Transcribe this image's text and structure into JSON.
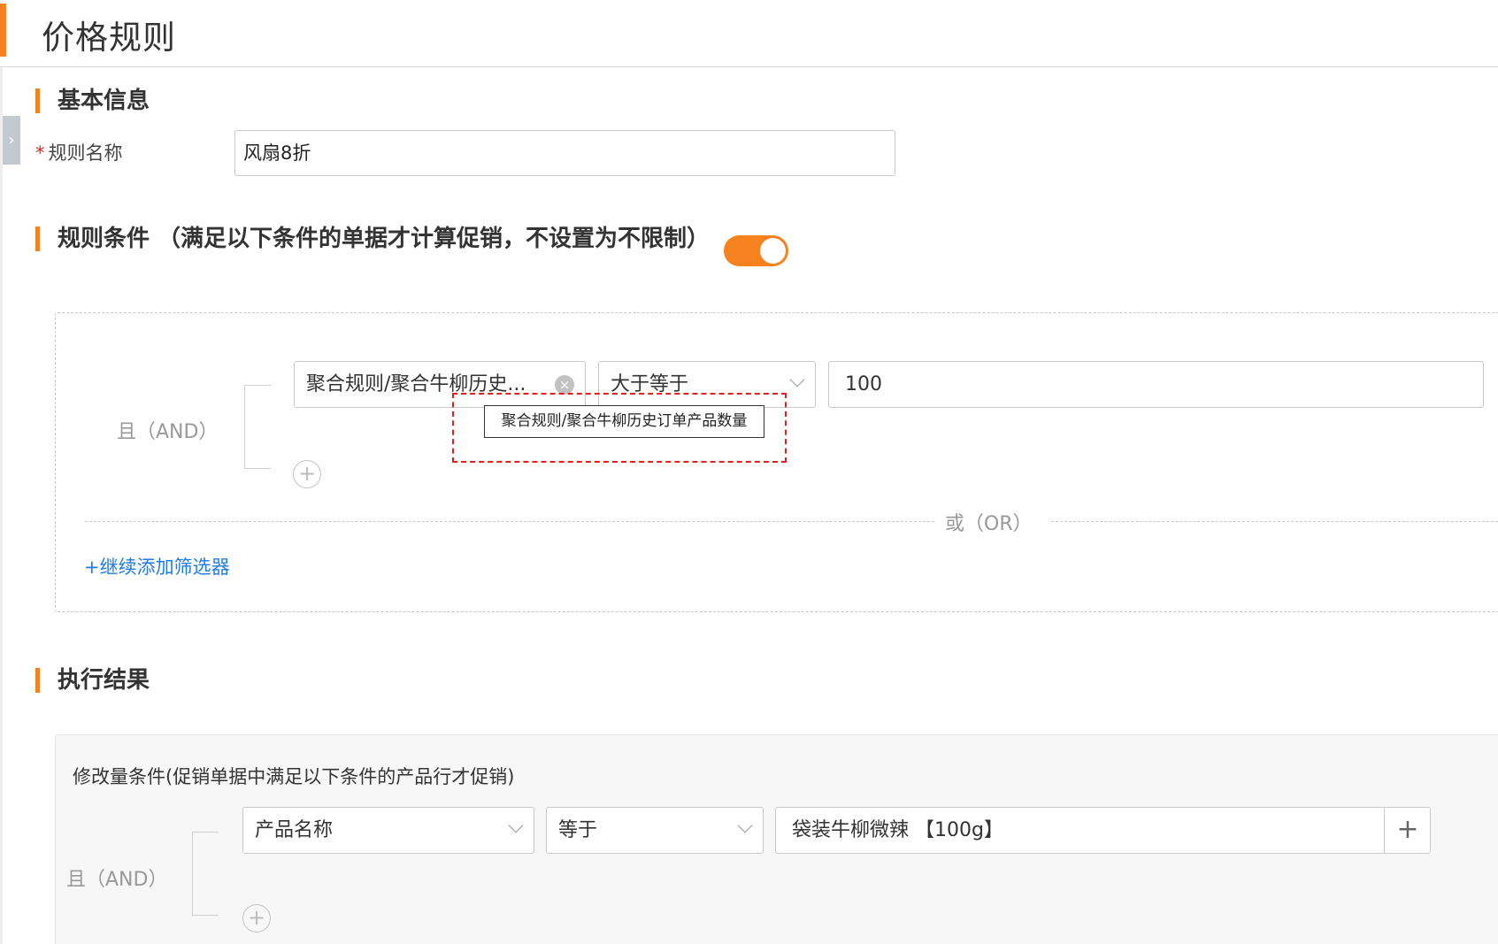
{
  "page": {
    "title": "价格规则"
  },
  "basic_info": {
    "section_title": "基本信息",
    "rule_name_label": "规则名称",
    "required_mark": "*",
    "rule_name_value": "风扇8折"
  },
  "conditions": {
    "section_title": "规则条件 （满足以下条件的单据才计算促销，不设置为不限制）",
    "enabled": true,
    "group_label": "且（AND）",
    "field_value": "聚合规则/聚合牛柳历史...",
    "operator_value": "大于等于",
    "compare_value": "100",
    "tooltip_text": "聚合规则/聚合牛柳历史订单产品数量",
    "or_label": "或（OR）",
    "add_filter_link": "+继续添加筛选器",
    "clear_icon": "×",
    "add_icon": "+"
  },
  "result": {
    "section_title": "执行结果",
    "description": "修改量条件(促销单据中满足以下条件的产品行才促销)",
    "group_label": "且（AND）",
    "field_value": "产品名称",
    "operator_value": "等于",
    "product_value": "袋装牛柳微辣 【100g】",
    "add_icon": "+"
  },
  "colors": {
    "accent": "#f5821f",
    "link": "#1f7ce6",
    "highlight": "#e0201c"
  }
}
